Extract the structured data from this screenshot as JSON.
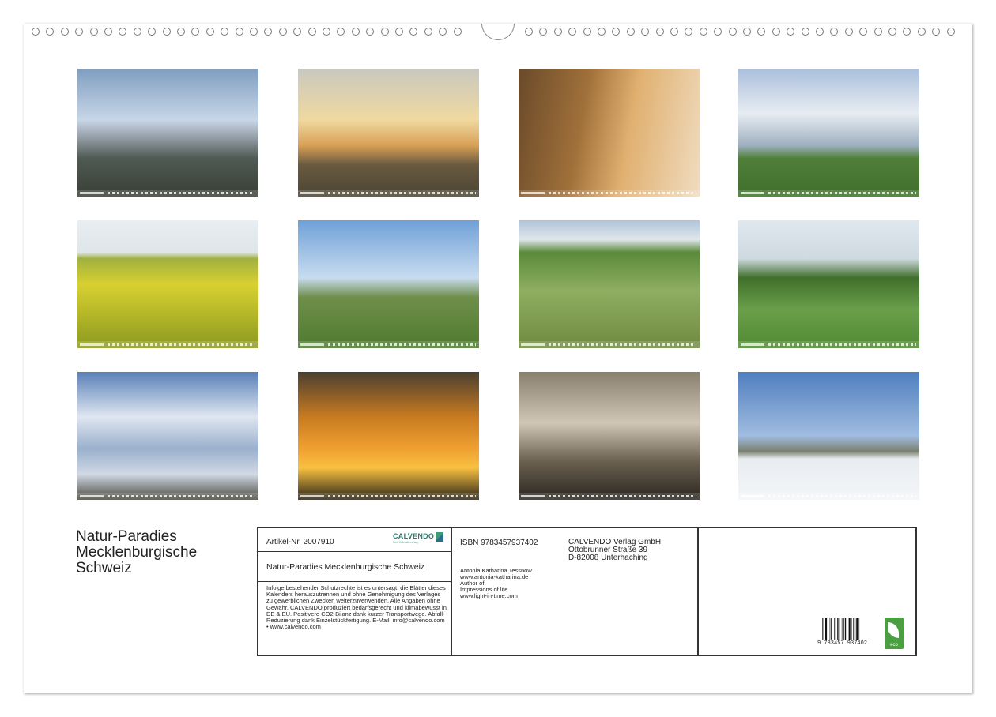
{
  "calendar_title": [
    "Natur-Paradies",
    "Mecklenburgische",
    "Schweiz"
  ],
  "thumbnails": [
    {
      "name": "thumb-lake-sun",
      "bg": "linear-gradient(180deg,#7f9ec0 0%,#c8d6e8 40%,#8f99a0 55%,#4f5a54 70%,#3a3f36 100%)"
    },
    {
      "name": "thumb-sunset-trees",
      "bg": "linear-gradient(180deg,#c9c8bf 0%,#f0d9a0 40%,#d8a055 60%,#6a5a40 75%,#4a4533 100%)"
    },
    {
      "name": "thumb-foggy-path",
      "bg": "linear-gradient(100deg,#6a4a2a 0%,#a0703a 35%,#e0b070 60%,#f0dcc0 100%)"
    },
    {
      "name": "thumb-cloudy-meadow",
      "bg": "linear-gradient(180deg,#aac0dc 0%,#e8ecf2 35%,#9fb0c0 60%,#4f7f3a 70%,#3f6f2a 100%)"
    },
    {
      "name": "thumb-rapeseed-field",
      "bg": "linear-gradient(180deg,#e8eef2 0%,#dfe6ea 25%,#a0b040 30%,#d8d030 50%,#8c9a20 100%)"
    },
    {
      "name": "thumb-willows",
      "bg": "linear-gradient(180deg,#6fa0d8 0%,#c8dcf0 45%,#6f8f4a 60%,#4f7a30 100%)"
    },
    {
      "name": "thumb-poppy-field",
      "bg": "linear-gradient(180deg,#b0c4d8 0%,#dfe6ec 15%,#5a8a3a 25%,#8fae60 55%,#6f8a40 100%)"
    },
    {
      "name": "thumb-river-meadow",
      "bg": "linear-gradient(180deg,#dfe8ee 0%,#cfd9e0 30%,#3f6f2a 45%,#6a9f4a 70%,#4f8a30 100%)"
    },
    {
      "name": "thumb-dramatic-clouds",
      "bg": "linear-gradient(180deg,#5a80b8 0%,#dfe6f0 35%,#9ab0cc 60%,#d0d8e4 80%,#4a4a40 100%)"
    },
    {
      "name": "thumb-orange-sunset",
      "bg": "linear-gradient(180deg,#4a4030 0%,#c87a20 35%,#f0a030 60%,#f8c040 75%,#2a2418 100%)"
    },
    {
      "name": "thumb-tree-silhouette",
      "bg": "linear-gradient(180deg,#8a8070 0%,#cfc6b6 40%,#6a6050 70%,#2a2620 100%)"
    },
    {
      "name": "thumb-snowy-field",
      "bg": "linear-gradient(180deg,#4f7fc0 0%,#a0bce0 50%,#7a8070 62%,#e8ecf0 68%,#f4f6f8 100%)"
    }
  ],
  "info": {
    "article": "Artikel-Nr. 2007910",
    "calvendo_logo": "CALVENDO",
    "calvendo_tagline": "Sein Kalenderverlag",
    "subtitle": "Natur-Paradies Mecklenburgische Schweiz",
    "legal": "Infolge bestehender Schutzrechte ist es untersagt, die Blätter dieses Kalenders herauszutrennen und ohne Genehmigung des Verlages zu gewerblichen Zwecken weiterzuverwenden. Alle Angaben ohne Gewähr. CALVENDO produziert bedarfsgerecht und klimabewusst in DE & EU. Positivere CO2-Bilanz dank kurzer Transportwege. Abfall-Reduzierung dank Einzelstückfertigung. E-Mail: info@calvendo.com • www.calvendo.com",
    "isbn": "ISBN 9783457937402",
    "publisher": [
      "CALVENDO Verlag GmbH",
      "Ottobrunner Straße 39",
      "D-82008 Unterhaching"
    ],
    "author": [
      "Antonia Katharina Tessnow",
      "www.antonia-katharina.de",
      "Author of",
      "Impressions of life",
      "www.light-in-time.com"
    ],
    "barcode_digits": "9  783457  937402",
    "eco_label": "eco"
  }
}
